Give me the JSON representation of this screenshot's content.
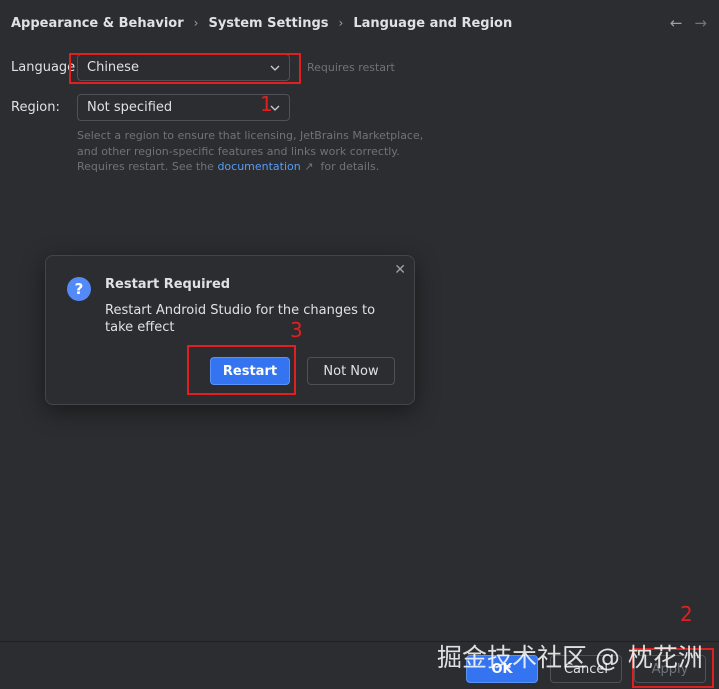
{
  "breadcrumb": {
    "items": [
      "Appearance & Behavior",
      "System Settings",
      "Language and Region"
    ]
  },
  "nav": {
    "back_icon": "arrow-left-icon",
    "forward_icon": "arrow-right-icon"
  },
  "language": {
    "label": "Language",
    "value": "Chinese",
    "hint": "Requires restart"
  },
  "region": {
    "label": "Region:",
    "value": "Not specified",
    "description_before_link": "Select a region to ensure that licensing, JetBrains Marketplace, and other region-specific features and links work correctly. Requires restart. See the",
    "link_text": "documentation",
    "link_arrow": "↗",
    "description_after_link": "for details."
  },
  "dialog": {
    "title": "Restart Required",
    "message": "Restart Android Studio for the changes to take effect",
    "icon_glyph": "?",
    "close_glyph": "✕",
    "primary_button": "Restart",
    "secondary_button": "Not Now"
  },
  "footer": {
    "ok_label": "OK",
    "cancel_label": "Cancel",
    "apply_label": "Apply"
  },
  "annotations": {
    "marker_1": "1",
    "marker_2": "2",
    "marker_3": "3",
    "color": "#e02020"
  },
  "watermark": "掘金技术社区 @ 枕花洲",
  "colors": {
    "background": "#2b2d30",
    "accent": "#3574f0",
    "link": "#589df6"
  }
}
